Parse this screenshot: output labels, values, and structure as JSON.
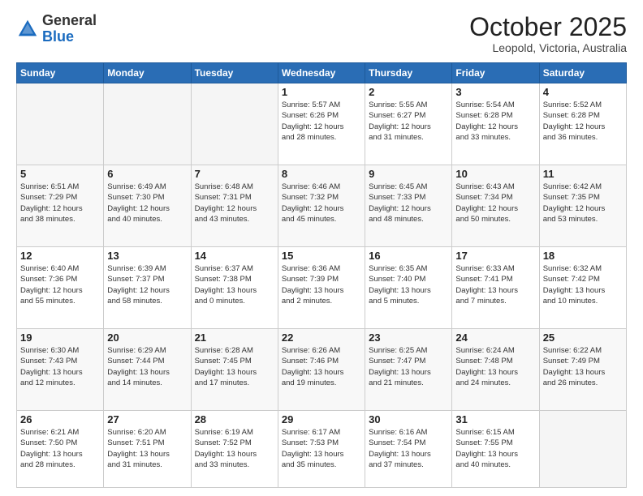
{
  "header": {
    "logo_general": "General",
    "logo_blue": "Blue",
    "month_title": "October 2025",
    "location": "Leopold, Victoria, Australia"
  },
  "days_of_week": [
    "Sunday",
    "Monday",
    "Tuesday",
    "Wednesday",
    "Thursday",
    "Friday",
    "Saturday"
  ],
  "weeks": [
    [
      {
        "day": "",
        "info": ""
      },
      {
        "day": "",
        "info": ""
      },
      {
        "day": "",
        "info": ""
      },
      {
        "day": "1",
        "info": "Sunrise: 5:57 AM\nSunset: 6:26 PM\nDaylight: 12 hours\nand 28 minutes."
      },
      {
        "day": "2",
        "info": "Sunrise: 5:55 AM\nSunset: 6:27 PM\nDaylight: 12 hours\nand 31 minutes."
      },
      {
        "day": "3",
        "info": "Sunrise: 5:54 AM\nSunset: 6:28 PM\nDaylight: 12 hours\nand 33 minutes."
      },
      {
        "day": "4",
        "info": "Sunrise: 5:52 AM\nSunset: 6:28 PM\nDaylight: 12 hours\nand 36 minutes."
      }
    ],
    [
      {
        "day": "5",
        "info": "Sunrise: 6:51 AM\nSunset: 7:29 PM\nDaylight: 12 hours\nand 38 minutes."
      },
      {
        "day": "6",
        "info": "Sunrise: 6:49 AM\nSunset: 7:30 PM\nDaylight: 12 hours\nand 40 minutes."
      },
      {
        "day": "7",
        "info": "Sunrise: 6:48 AM\nSunset: 7:31 PM\nDaylight: 12 hours\nand 43 minutes."
      },
      {
        "day": "8",
        "info": "Sunrise: 6:46 AM\nSunset: 7:32 PM\nDaylight: 12 hours\nand 45 minutes."
      },
      {
        "day": "9",
        "info": "Sunrise: 6:45 AM\nSunset: 7:33 PM\nDaylight: 12 hours\nand 48 minutes."
      },
      {
        "day": "10",
        "info": "Sunrise: 6:43 AM\nSunset: 7:34 PM\nDaylight: 12 hours\nand 50 minutes."
      },
      {
        "day": "11",
        "info": "Sunrise: 6:42 AM\nSunset: 7:35 PM\nDaylight: 12 hours\nand 53 minutes."
      }
    ],
    [
      {
        "day": "12",
        "info": "Sunrise: 6:40 AM\nSunset: 7:36 PM\nDaylight: 12 hours\nand 55 minutes."
      },
      {
        "day": "13",
        "info": "Sunrise: 6:39 AM\nSunset: 7:37 PM\nDaylight: 12 hours\nand 58 minutes."
      },
      {
        "day": "14",
        "info": "Sunrise: 6:37 AM\nSunset: 7:38 PM\nDaylight: 13 hours\nand 0 minutes."
      },
      {
        "day": "15",
        "info": "Sunrise: 6:36 AM\nSunset: 7:39 PM\nDaylight: 13 hours\nand 2 minutes."
      },
      {
        "day": "16",
        "info": "Sunrise: 6:35 AM\nSunset: 7:40 PM\nDaylight: 13 hours\nand 5 minutes."
      },
      {
        "day": "17",
        "info": "Sunrise: 6:33 AM\nSunset: 7:41 PM\nDaylight: 13 hours\nand 7 minutes."
      },
      {
        "day": "18",
        "info": "Sunrise: 6:32 AM\nSunset: 7:42 PM\nDaylight: 13 hours\nand 10 minutes."
      }
    ],
    [
      {
        "day": "19",
        "info": "Sunrise: 6:30 AM\nSunset: 7:43 PM\nDaylight: 13 hours\nand 12 minutes."
      },
      {
        "day": "20",
        "info": "Sunrise: 6:29 AM\nSunset: 7:44 PM\nDaylight: 13 hours\nand 14 minutes."
      },
      {
        "day": "21",
        "info": "Sunrise: 6:28 AM\nSunset: 7:45 PM\nDaylight: 13 hours\nand 17 minutes."
      },
      {
        "day": "22",
        "info": "Sunrise: 6:26 AM\nSunset: 7:46 PM\nDaylight: 13 hours\nand 19 minutes."
      },
      {
        "day": "23",
        "info": "Sunrise: 6:25 AM\nSunset: 7:47 PM\nDaylight: 13 hours\nand 21 minutes."
      },
      {
        "day": "24",
        "info": "Sunrise: 6:24 AM\nSunset: 7:48 PM\nDaylight: 13 hours\nand 24 minutes."
      },
      {
        "day": "25",
        "info": "Sunrise: 6:22 AM\nSunset: 7:49 PM\nDaylight: 13 hours\nand 26 minutes."
      }
    ],
    [
      {
        "day": "26",
        "info": "Sunrise: 6:21 AM\nSunset: 7:50 PM\nDaylight: 13 hours\nand 28 minutes."
      },
      {
        "day": "27",
        "info": "Sunrise: 6:20 AM\nSunset: 7:51 PM\nDaylight: 13 hours\nand 31 minutes."
      },
      {
        "day": "28",
        "info": "Sunrise: 6:19 AM\nSunset: 7:52 PM\nDaylight: 13 hours\nand 33 minutes."
      },
      {
        "day": "29",
        "info": "Sunrise: 6:17 AM\nSunset: 7:53 PM\nDaylight: 13 hours\nand 35 minutes."
      },
      {
        "day": "30",
        "info": "Sunrise: 6:16 AM\nSunset: 7:54 PM\nDaylight: 13 hours\nand 37 minutes."
      },
      {
        "day": "31",
        "info": "Sunrise: 6:15 AM\nSunset: 7:55 PM\nDaylight: 13 hours\nand 40 minutes."
      },
      {
        "day": "",
        "info": ""
      }
    ]
  ]
}
